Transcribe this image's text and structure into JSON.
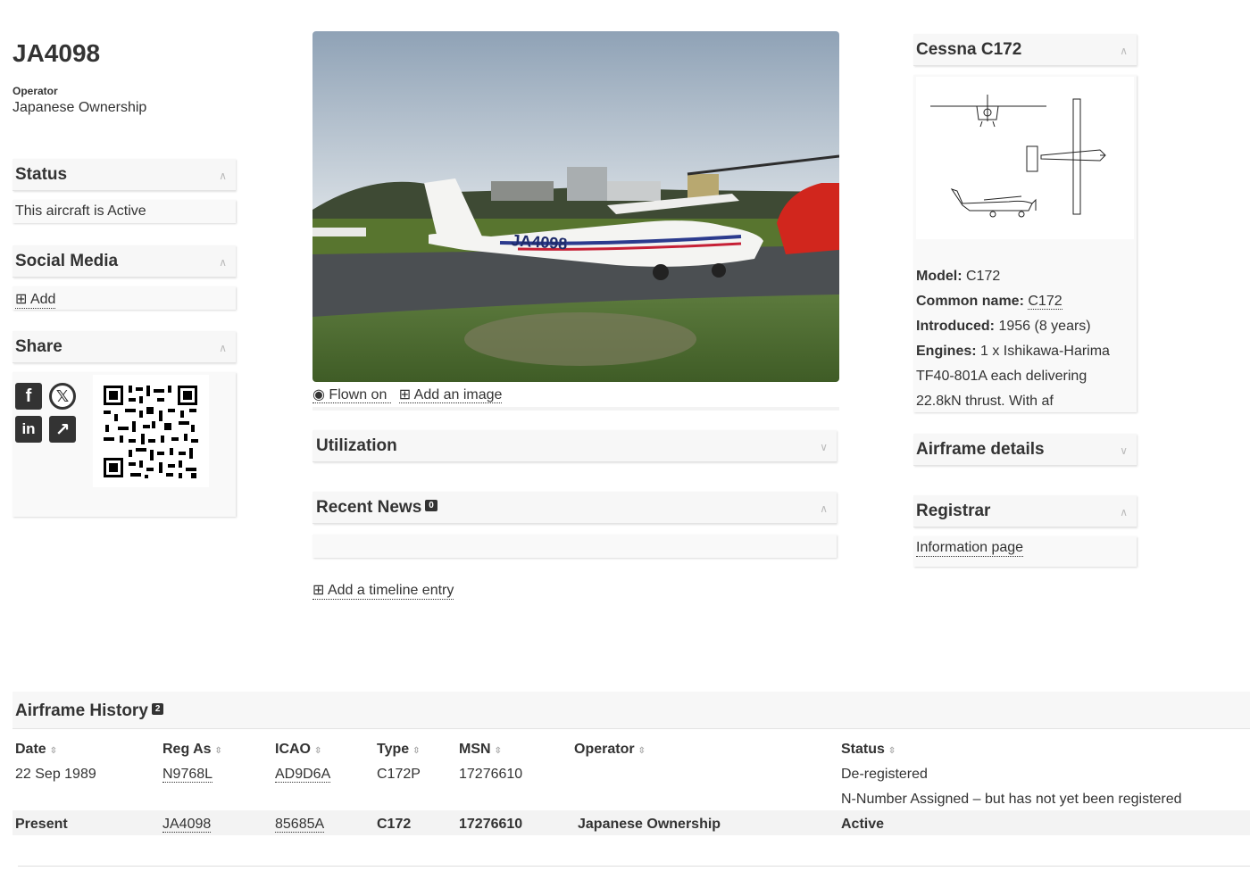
{
  "aircraft": {
    "registration": "JA4098",
    "operator_label": "Operator",
    "operator": "Japanese Ownership"
  },
  "status_panel": {
    "title": "Status",
    "text": "This aircraft is Active"
  },
  "social_panel": {
    "title": "Social Media",
    "add_label": "Add"
  },
  "share_panel": {
    "title": "Share"
  },
  "photo": {
    "flown_on_label": "Flown on",
    "add_image_label": "Add an image",
    "tail_text": "JA4098"
  },
  "utilization": {
    "title": "Utilization"
  },
  "news": {
    "title": "Recent News",
    "count": "0"
  },
  "timeline": {
    "add_label": "Add a timeline entry"
  },
  "type_panel": {
    "title": "Cessna C172",
    "model_label": "Model:",
    "model_value": "C172",
    "common_label": "Common name:",
    "common_value": "C172",
    "introduced_label": "Introduced:",
    "introduced_value": "1956 (8 years)",
    "engines_label": "Engines:",
    "engines_line1": "1 x Ishikawa-Harima",
    "engines_line2": "TF40-801A each delivering",
    "engines_line3": "22.8kN thrust. With af"
  },
  "airframe_details": {
    "title": "Airframe details"
  },
  "registrar": {
    "title": "Registrar",
    "link": "Information page"
  },
  "history": {
    "title": "Airframe History",
    "count": "2",
    "columns": [
      "Date",
      "Reg As",
      "ICAO",
      "Type",
      "MSN",
      "Operator",
      "Status"
    ],
    "rows": [
      {
        "date": "22 Sep 1989",
        "reg": "N9768L",
        "icao": "AD9D6A",
        "type": "C172P",
        "msn": "17276610",
        "operator": "",
        "status": "De-registered",
        "status_note": "N-Number Assigned – but has not yet been registered"
      },
      {
        "date": "Present",
        "reg": "JA4098",
        "icao": "85685A",
        "type": "C172",
        "msn": "17276610",
        "operator": "Japanese Ownership",
        "status": "Active",
        "status_note": ""
      }
    ]
  },
  "colors": {
    "text": "#333333",
    "panel_bg": "#f7f7f7",
    "badge": "#333333"
  }
}
